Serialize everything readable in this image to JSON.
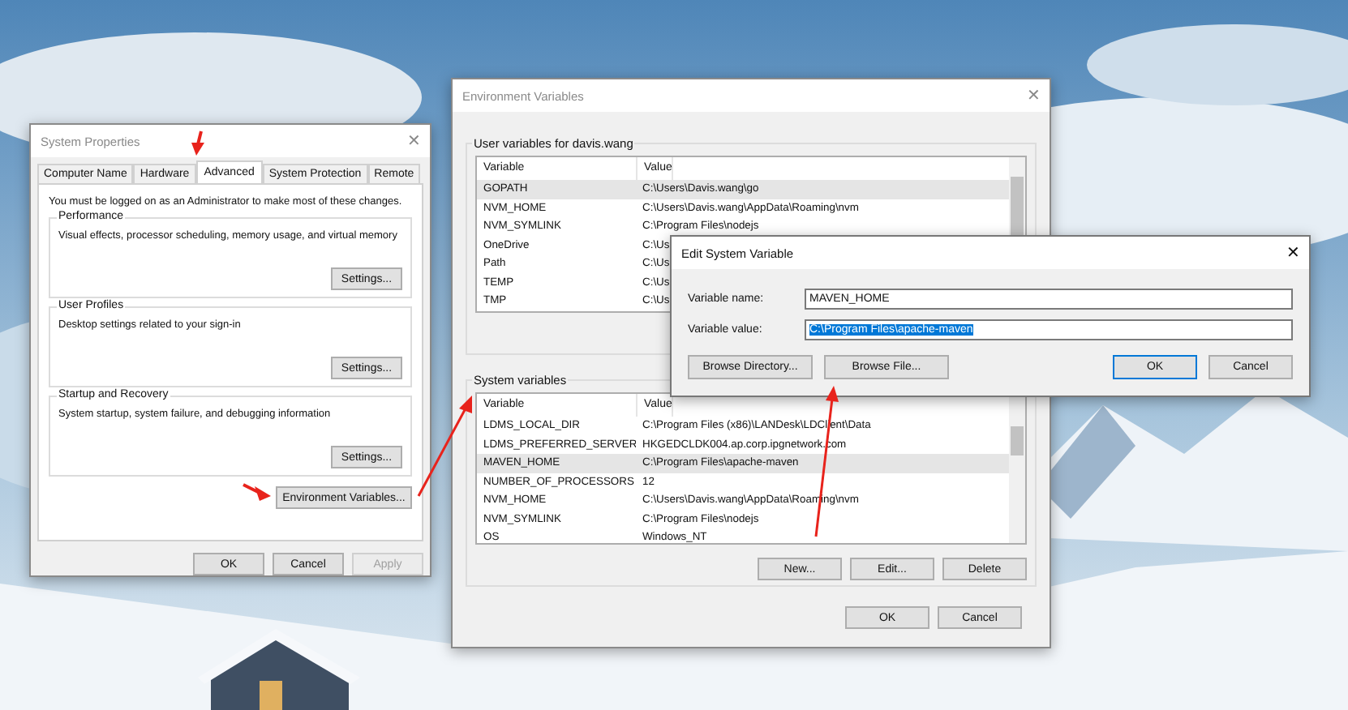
{
  "system_properties": {
    "title": "System Properties",
    "close": "✕",
    "tabs": [
      {
        "label": "Computer Name",
        "selected": false
      },
      {
        "label": "Hardware",
        "selected": false
      },
      {
        "label": "Advanced",
        "selected": true
      },
      {
        "label": "System Protection",
        "selected": false
      },
      {
        "label": "Remote",
        "selected": false
      }
    ],
    "notice": "You must be logged on as an Administrator to make most of these changes.",
    "groups": [
      {
        "title": "Performance",
        "description": "Visual effects, processor scheduling, memory usage, and virtual memory",
        "button": "Settings..."
      },
      {
        "title": "User Profiles",
        "description": "Desktop settings related to your sign-in",
        "button": "Settings..."
      },
      {
        "title": "Startup and Recovery",
        "description": "System startup, system failure, and debugging information",
        "button": "Settings..."
      }
    ],
    "env_button": "Environment Variables...",
    "buttons": [
      {
        "label": "OK",
        "disabled": false
      },
      {
        "label": "Cancel",
        "disabled": false
      },
      {
        "label": "Apply",
        "disabled": true
      }
    ]
  },
  "environment_variables": {
    "title": "Environment Variables",
    "close": "✕",
    "user_group": {
      "title": "User variables for davis.wang",
      "columns": [
        "Variable",
        "Value"
      ],
      "rows": [
        {
          "variable": "GOPATH",
          "value": "C:\\Users\\Davis.wang\\go",
          "selected": true
        },
        {
          "variable": "NVM_HOME",
          "value": "C:\\Users\\Davis.wang\\AppData\\Roaming\\nvm",
          "selected": false
        },
        {
          "variable": "NVM_SYMLINK",
          "value": "C:\\Program Files\\nodejs",
          "selected": false
        },
        {
          "variable": "OneDrive",
          "value": "C:\\Us",
          "selected": false
        },
        {
          "variable": "Path",
          "value": "C:\\Us",
          "selected": false
        },
        {
          "variable": "TEMP",
          "value": "C:\\Us",
          "selected": false
        },
        {
          "variable": "TMP",
          "value": "C:\\Us",
          "selected": false
        }
      ]
    },
    "system_group": {
      "title": "System variables",
      "columns": [
        "Variable",
        "Value"
      ],
      "rows": [
        {
          "variable": "LDMS_LOCAL_DIR",
          "value": "C:\\Program Files (x86)\\LANDesk\\LDClient\\Data",
          "selected": false
        },
        {
          "variable": "LDMS_PREFERRED_SERVER",
          "value": "HKGEDCLDK004.ap.corp.ipgnetwork.com",
          "selected": false
        },
        {
          "variable": "MAVEN_HOME",
          "value": "C:\\Program Files\\apache-maven",
          "selected": true
        },
        {
          "variable": "NUMBER_OF_PROCESSORS",
          "value": "12",
          "selected": false
        },
        {
          "variable": "NVM_HOME",
          "value": "C:\\Users\\Davis.wang\\AppData\\Roaming\\nvm",
          "selected": false
        },
        {
          "variable": "NVM_SYMLINK",
          "value": "C:\\Program Files\\nodejs",
          "selected": false
        },
        {
          "variable": "OS",
          "value": "Windows_NT",
          "selected": false
        }
      ]
    },
    "system_buttons": [
      "New...",
      "Edit...",
      "Delete"
    ],
    "buttons": [
      "OK",
      "Cancel"
    ]
  },
  "edit_dialog": {
    "title": "Edit System Variable",
    "close": "✕",
    "fields": [
      {
        "label": "Variable name:",
        "value": "MAVEN_HOME",
        "selected": false
      },
      {
        "label": "Variable value:",
        "value": "C:\\Program Files\\apache-maven",
        "selected": true
      }
    ],
    "buttons": [
      {
        "label": "Browse Directory...",
        "default": false
      },
      {
        "label": "Browse File...",
        "default": false
      },
      {
        "label": "OK",
        "default": true
      },
      {
        "label": "Cancel",
        "default": false
      }
    ]
  }
}
